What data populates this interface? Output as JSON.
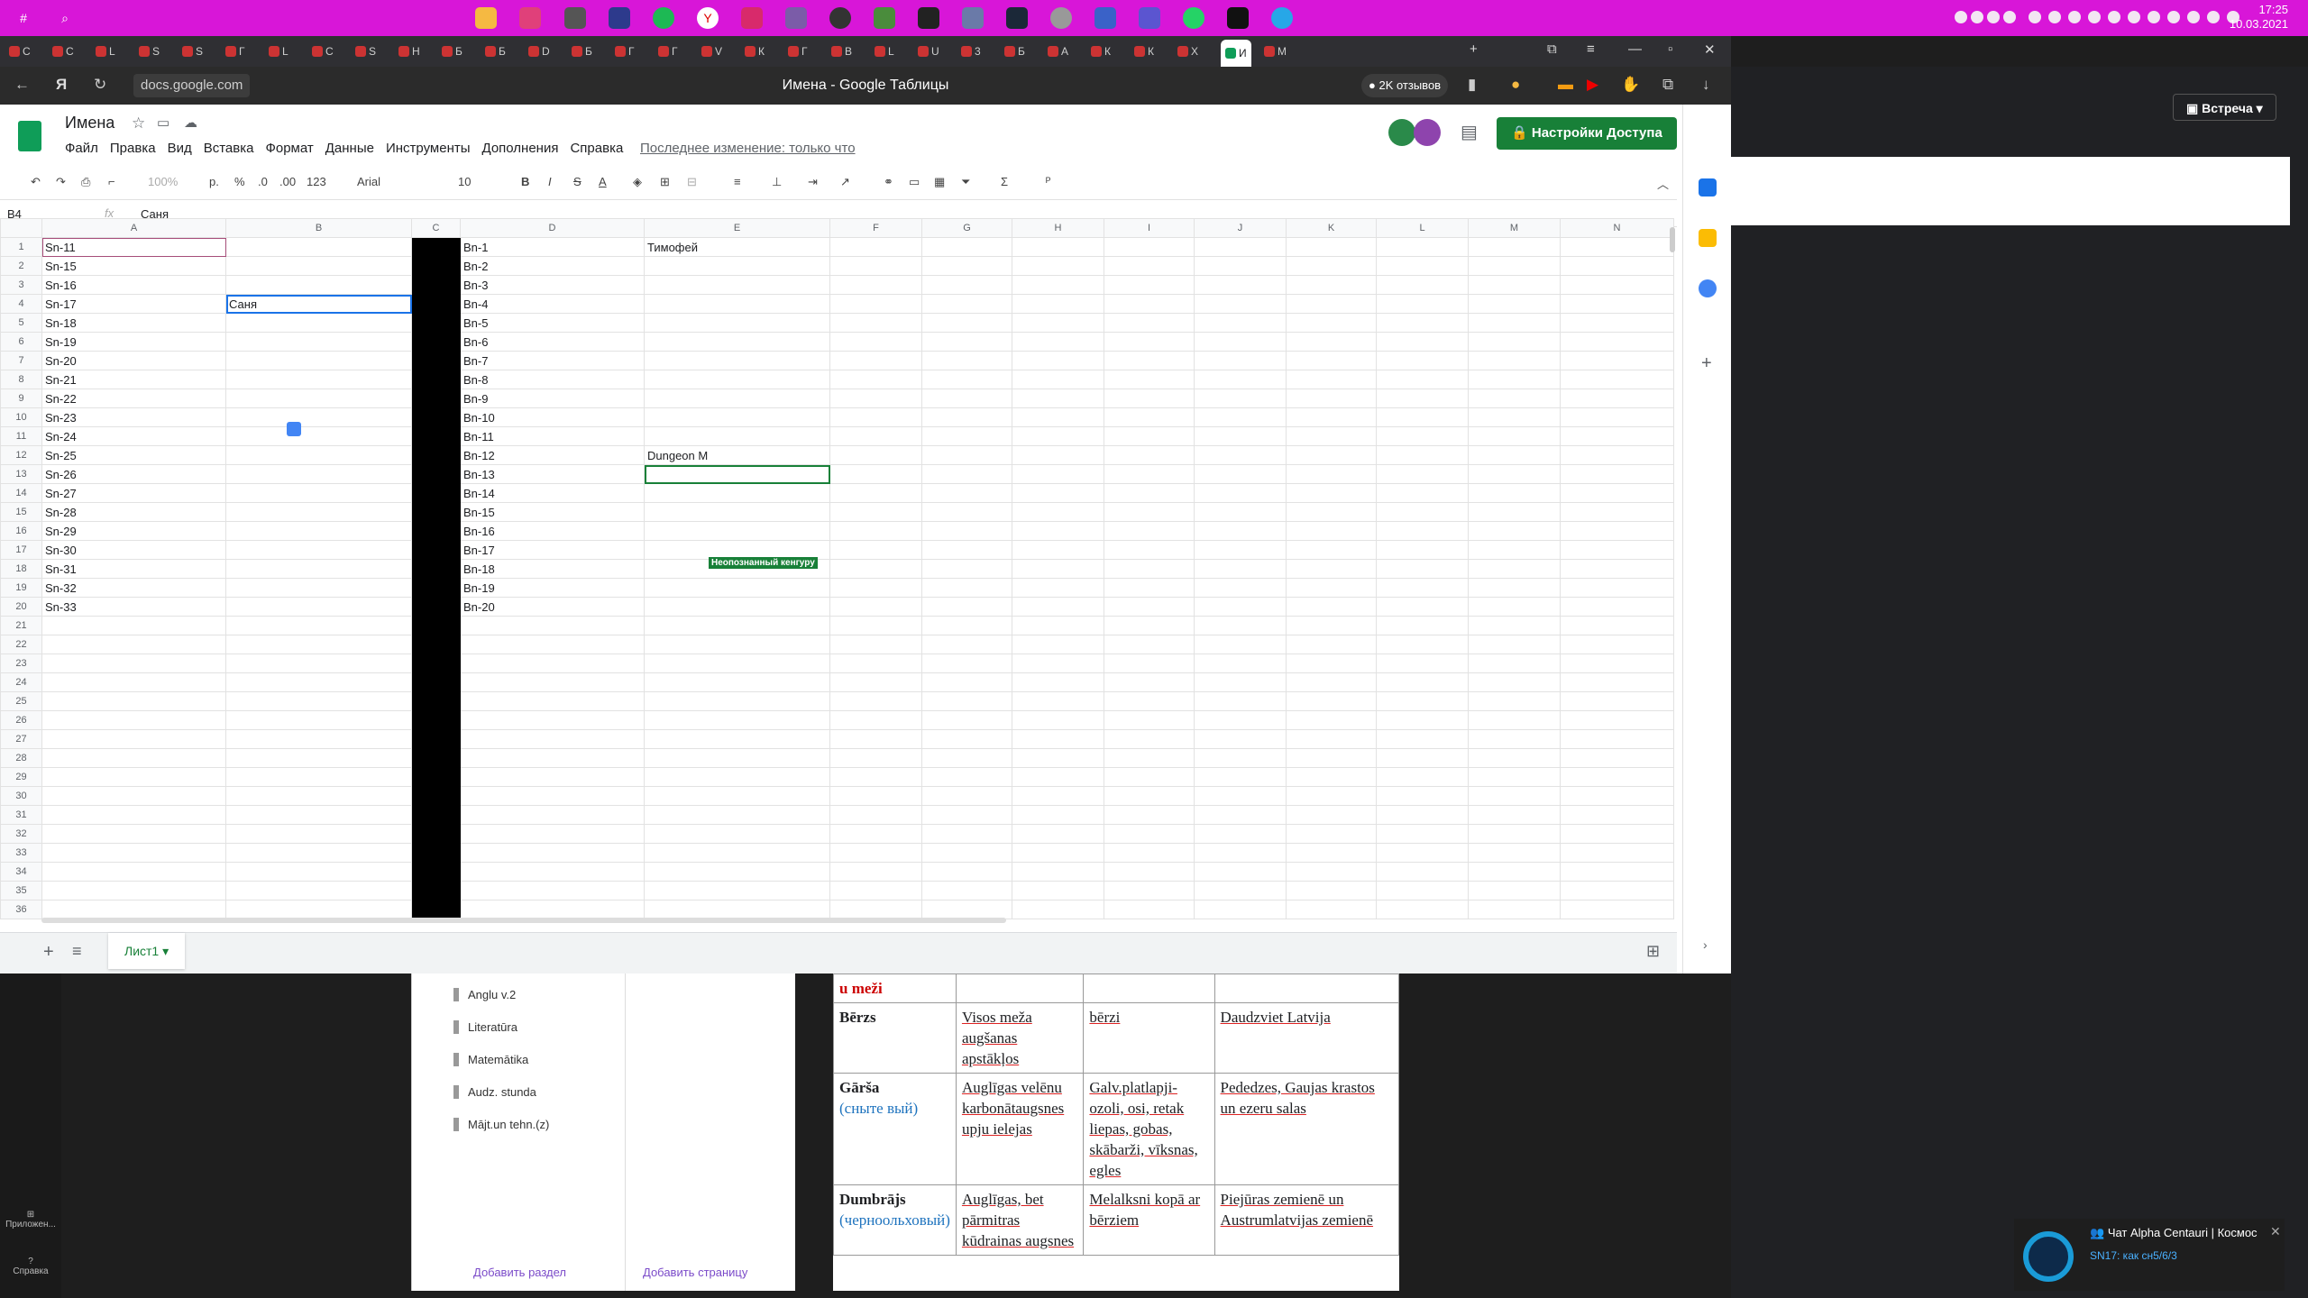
{
  "taskbar": {
    "left_icons": [
      "hash-icon",
      "search-icon"
    ],
    "left_labels": [
      "#",
      "⌕"
    ],
    "clock_time": "17:25",
    "clock_date": "10.03.2021"
  },
  "tabs": [
    {
      "label": "C"
    },
    {
      "label": "C"
    },
    {
      "label": "L"
    },
    {
      "label": "S"
    },
    {
      "label": "S"
    },
    {
      "label": "Г"
    },
    {
      "label": "L"
    },
    {
      "label": "С"
    },
    {
      "label": "S"
    },
    {
      "label": "Н"
    },
    {
      "label": "Б"
    },
    {
      "label": "Б"
    },
    {
      "label": "D"
    },
    {
      "label": "Б"
    },
    {
      "label": "Г"
    },
    {
      "label": "Г"
    },
    {
      "label": "V"
    },
    {
      "label": "К"
    },
    {
      "label": "Г"
    },
    {
      "label": "В"
    },
    {
      "label": "L"
    },
    {
      "label": "U"
    },
    {
      "label": "3"
    },
    {
      "label": "Б"
    },
    {
      "label": "А"
    },
    {
      "label": "К"
    },
    {
      "label": "К"
    },
    {
      "label": "Х"
    },
    {
      "label": "И"
    },
    {
      "label": "М"
    }
  ],
  "browser": {
    "url": "docs.google.com",
    "page_title": "Имена - Google Таблицы",
    "reviews": "2K отзывов"
  },
  "doc": {
    "title": "Имена",
    "menu": [
      "Файл",
      "Правка",
      "Вид",
      "Вставка",
      "Формат",
      "Данные",
      "Инструменты",
      "Дополнения",
      "Справка"
    ],
    "last_edit": "Последнее изменение: только что",
    "share": "Настройки Доступа"
  },
  "toolbar": {
    "zoom": "100%",
    "currency": "р.",
    "percent": "%",
    "dec_less": ".0",
    "dec_more": ".00",
    "format": "123",
    "font": "Arial",
    "size": "10",
    "bold": "B",
    "italic": "I",
    "strike": "S",
    "textcolor": "A",
    "sigma": "Σ"
  },
  "formula": {
    "cell": "B4",
    "fx": "fx",
    "value": "Саня"
  },
  "sheet": {
    "columns": [
      "A",
      "B",
      "C",
      "D",
      "E",
      "F",
      "G",
      "H",
      "I",
      "J",
      "K",
      "L",
      "M",
      "N"
    ],
    "rows": 36,
    "colA": [
      "Sn-11",
      "Sn-15",
      "Sn-16",
      "Sn-17",
      "Sn-18",
      "Sn-19",
      "Sn-20",
      "Sn-21",
      "Sn-22",
      "Sn-23",
      "Sn-24",
      "Sn-25",
      "Sn-26",
      "Sn-27",
      "Sn-28",
      "Sn-29",
      "Sn-30",
      "Sn-31",
      "Sn-32",
      "Sn-33"
    ],
    "colB": {
      "4": "Саня"
    },
    "colD": [
      "Bn-1",
      "Bn-2",
      "Bn-3",
      "Bn-4",
      "Bn-5",
      "Bn-6",
      "Bn-7",
      "Bn-8",
      "Bn-9",
      "Bn-10",
      "Bn-11",
      "Bn-12",
      "Bn-13",
      "Bn-14",
      "Bn-15",
      "Bn-16",
      "Bn-17",
      "Bn-18",
      "Bn-19",
      "Bn-20"
    ],
    "colE": {
      "1": "Тимофей",
      "12": "Dungeon M"
    },
    "kangaroo": "Неопознанный кенгуру",
    "tab_name": "Лист1"
  },
  "meet": {
    "button": "Встреча"
  },
  "lefttools": {
    "apps": "Приложен...",
    "help": "Справка"
  },
  "notebook": {
    "items": [
      "Anglu v.2",
      "Literatūra",
      "Matemātika",
      "Audz. stunda",
      "Mājt.un tehn.(z)"
    ],
    "add_section": "Добавить раздел",
    "add_page": "Добавить страницу"
  },
  "doctable": {
    "top_fragment": "u meži",
    "rows": [
      {
        "name": "Bērzs",
        "ru": "",
        "c2": "Visos meža augšanas apstākļos",
        "c3": "bērzi",
        "c4": "Daudzviet Latvija"
      },
      {
        "name": "Gārša",
        "ru": "(сныте вый)",
        "c2": "Auglīgas velēnu karbonātaugsnes upju ielejas",
        "c3": "Galv.platlapji-ozoli, osi, retak liepas, gobas, skābarži, vīksnas, egles",
        "c4": "Pededzes, Gaujas krastos un ezeru salas"
      },
      {
        "name": "Dumbrājs",
        "ru": "(черноольховый)",
        "c2": "Auglīgas, bet pārmitras kūdrainas augsnes",
        "c3": "Melalksni kopā ar bērziem",
        "c4": "Piejūras zemienē un Austrumlatvijas zemienē"
      }
    ]
  },
  "chat": {
    "title": "Чат Alpha Centauri | Космос",
    "message": "SN17: как сн5/6/3"
  }
}
